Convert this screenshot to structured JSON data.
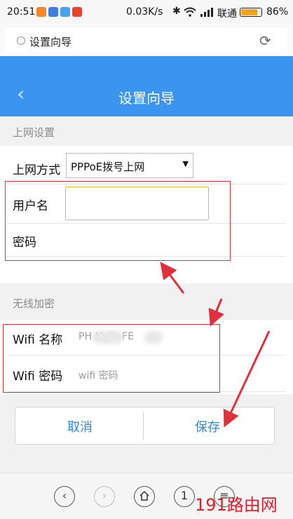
{
  "status_bar": {
    "time": "20:51",
    "net_speed": "0.03K/s",
    "carrier": "联通",
    "battery_percent": "86%",
    "battery_level": 0.86,
    "app_icon_colors": [
      "#f5872a",
      "#3f7fe0",
      "#4aa0ea",
      "#e8442e"
    ]
  },
  "browser": {
    "tab_title": "设置向导",
    "reload_icon": "reload-icon"
  },
  "header": {
    "title": "设置向导",
    "back_glyph": "‹",
    "color": "#3b95f0"
  },
  "section_internet": {
    "title": "上网设置",
    "method_label": "上网方式",
    "method_value": "PPPoE拨号上网",
    "username_label": "用户名",
    "username_value": "",
    "password_label": "密码"
  },
  "section_wireless": {
    "title": "无线加密",
    "wifi_name_label": "Wifi 名称",
    "wifi_name_value": "PH      M_D.    FE",
    "wifi_password_label": "Wifi 密码",
    "wifi_password_placeholder": "wifi 密码"
  },
  "buttons": {
    "cancel": "取消",
    "save": "保存",
    "accent": "#2f86d8"
  },
  "bottom_nav": {
    "back_glyph": "‹",
    "forward_glyph": "›",
    "tabs_count": "1"
  },
  "watermark": {
    "text": "191路由网",
    "color": "#e01e2a"
  },
  "annotation_color": "#e0303c"
}
